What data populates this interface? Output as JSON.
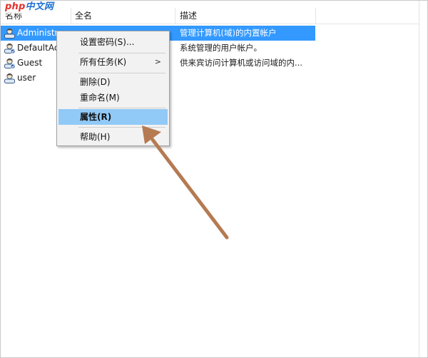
{
  "watermark": {
    "php": "php",
    "cn": "中文网"
  },
  "columns": [
    "名称",
    "全名",
    "描述"
  ],
  "users": [
    {
      "name": "Administrat",
      "fullname": "",
      "desc": "管理计算机(域)的内置帐户",
      "selected": true
    },
    {
      "name": "DefaultAcc",
      "fullname": "",
      "desc": "系统管理的用户帐户。",
      "selected": false
    },
    {
      "name": "Guest",
      "fullname": "",
      "desc": "供来宾访问计算机或访问域的内...",
      "selected": false
    },
    {
      "name": "user",
      "fullname": "",
      "desc": "",
      "selected": false
    }
  ],
  "context_menu": {
    "set_password": "设置密码(S)...",
    "all_tasks": "所有任务(K)",
    "all_tasks_arrow": ">",
    "delete": "删除(D)",
    "rename": "重命名(M)",
    "properties": "属性(R)",
    "help": "帮助(H)"
  },
  "colors": {
    "selection": "#3399ff",
    "menu_highlight": "#91c9f7",
    "annotation_arrow": "#b57a52"
  },
  "icons": [
    "user-icon"
  ]
}
